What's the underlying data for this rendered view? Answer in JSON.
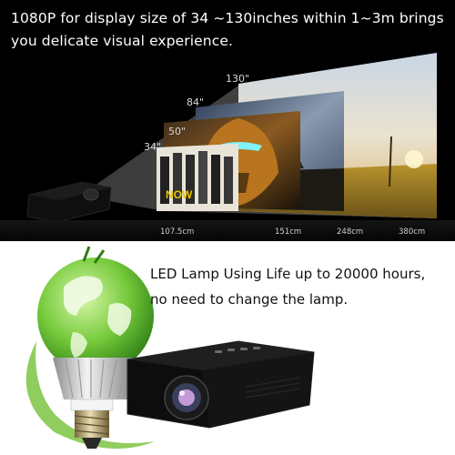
{
  "headline": {
    "line1": "1080P for display size of 34 ~130inches within 1~3m brings",
    "line2": "you delicate visual experience."
  },
  "screen_sizes": [
    "130\"",
    "84\"",
    "50\"",
    "34\""
  ],
  "distances": [
    "107.5cm",
    "151cm",
    "248cm",
    "380cm"
  ],
  "lamp_text": {
    "line1": "LED Lamp Using Life up to 20000 hours,",
    "line2": "no need to change the lamp."
  }
}
